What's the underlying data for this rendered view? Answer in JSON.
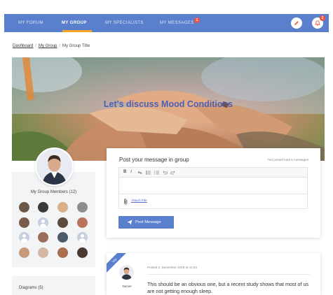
{
  "nav": {
    "items": [
      {
        "label": "MY FORUM"
      },
      {
        "label": "MY GROUP",
        "active": true
      },
      {
        "label": "MY SPECIALISTS"
      },
      {
        "label": "MY MESSAGES",
        "badge": "1"
      }
    ],
    "notification_badge": "2",
    "edit_icon": "pencil-icon",
    "notification_icon": "bell-icon"
  },
  "breadcrumb": {
    "items": [
      "Dashboard",
      "My Group",
      "My Group Title"
    ]
  },
  "hero": {
    "title": "Let's discuss Mood Conditions"
  },
  "sidebar": {
    "members_title": "My Group Members (12)",
    "diagrams_title": "Diagrams (5)"
  },
  "post": {
    "title": "Post your message in group",
    "meta": "You posted total 5 messages",
    "toolbar": [
      "B",
      "I",
      "link",
      "bullet-list",
      "numbered-list",
      "undo",
      "redo"
    ],
    "attach_label": "Attach File",
    "submit_label": "Post Message"
  },
  "message": {
    "ribbon": "You",
    "author": "Daniel",
    "date": "Posted 2, December 2019 at 11:53",
    "text": "This should be an obvious one, but a recent study shows that most of us are not getting enough sleep."
  },
  "colors": {
    "primary": "#5a7fcc",
    "accent": "#f5a623",
    "badge": "#f0533e",
    "hero_title": "#4a5fb8"
  }
}
